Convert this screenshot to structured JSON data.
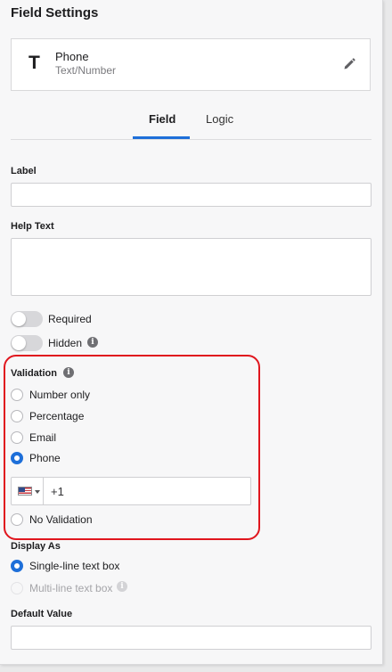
{
  "header": {
    "title": "Field Settings"
  },
  "field_card": {
    "type_letter": "T",
    "name": "Phone",
    "type_label": "Text/Number",
    "edit_icon": "pencil-icon"
  },
  "tabs": [
    {
      "label": "Field",
      "active": true
    },
    {
      "label": "Logic",
      "active": false
    }
  ],
  "label_field": {
    "label": "Label",
    "value": ""
  },
  "help_text": {
    "label": "Help Text",
    "value": ""
  },
  "toggles": {
    "required": {
      "label": "Required",
      "on": false
    },
    "hidden": {
      "label": "Hidden",
      "on": false,
      "icon": "info-icon"
    }
  },
  "validation": {
    "label": "Validation",
    "icon": "info-icon",
    "options": [
      "Number only",
      "Percentage",
      "Email",
      "Phone"
    ],
    "selected": "Phone",
    "phone": {
      "country_flag": "us-flag-icon",
      "dial_code": "+1"
    },
    "no_validation_label": "No Validation"
  },
  "display_as": {
    "label": "Display As",
    "options": [
      {
        "label": "Single-line text box",
        "selected": true,
        "disabled": false
      },
      {
        "label": "Multi-line text box",
        "selected": false,
        "disabled": true
      }
    ]
  },
  "default_value": {
    "label": "Default Value",
    "value": ""
  },
  "colors": {
    "accent": "#1e6fd9",
    "highlight": "#e0161e"
  }
}
